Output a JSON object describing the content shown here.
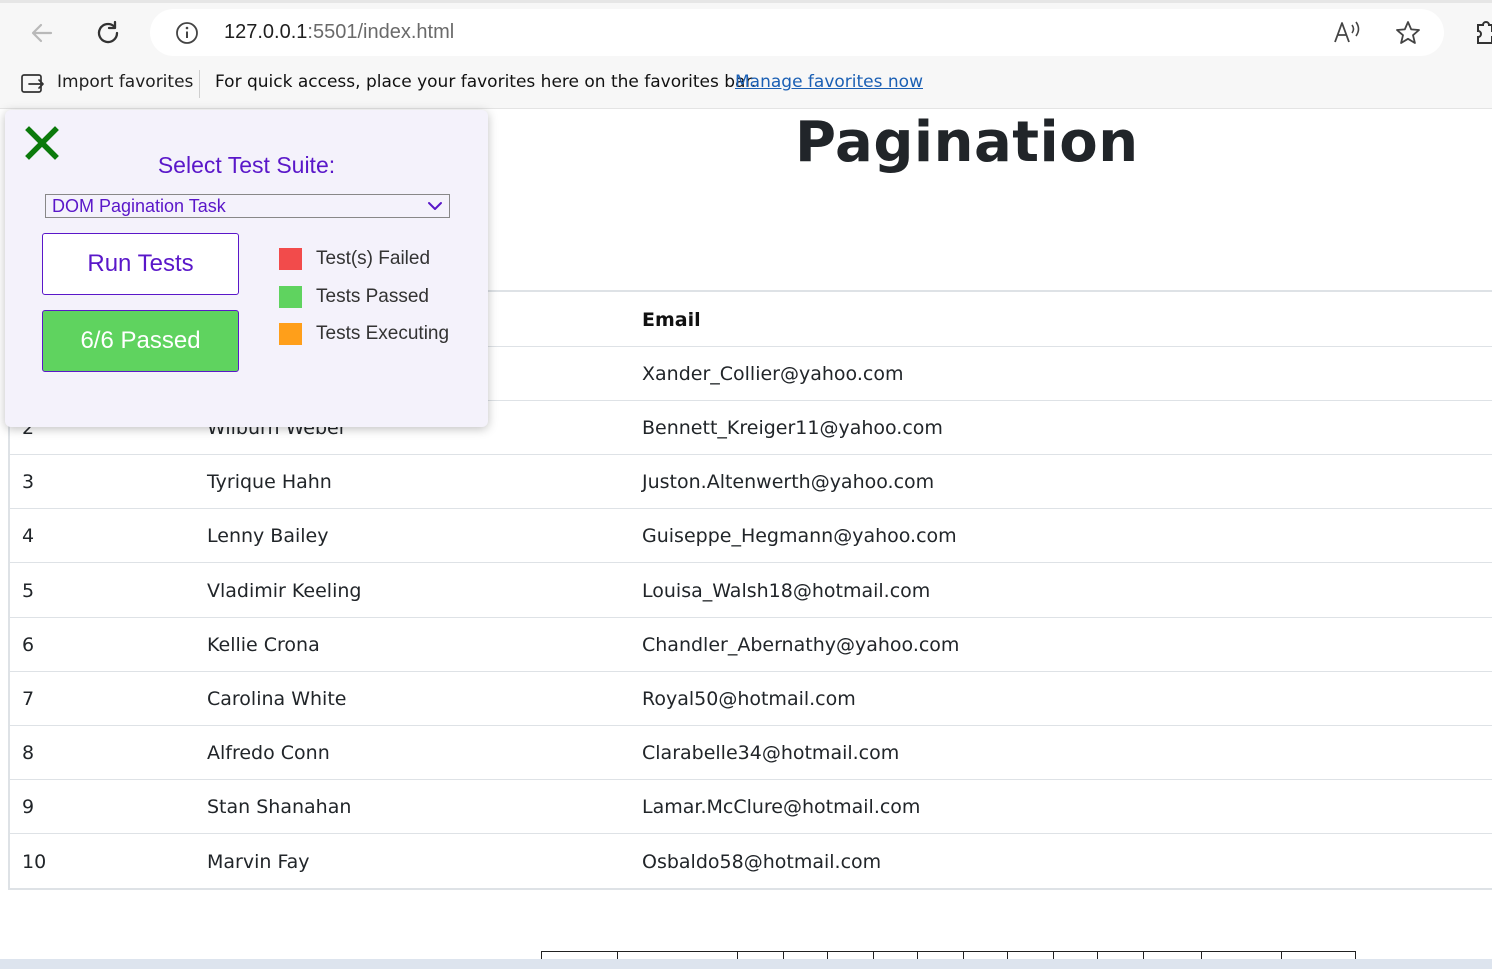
{
  "browser": {
    "url_host": "127.0.0.1",
    "url_path": ":5501/index.html",
    "read_aloud_glyph": "Aᴺ",
    "favorites_bar": {
      "import_label": "Import favorites",
      "message": "For quick access, place your favorites here on the favorites bar.",
      "manage_link": "Manage favorites now"
    }
  },
  "page": {
    "title": "Pagination",
    "table": {
      "columns": [
        "",
        "",
        "Email"
      ],
      "rows": [
        {
          "id": "2",
          "name": "Wilburn Weber",
          "email": "Bennett_Kreiger11@yahoo.com"
        },
        {
          "id": "3",
          "name": "Tyrique Hahn",
          "email": "Juston.Altenwerth@yahoo.com"
        },
        {
          "id": "4",
          "name": "Lenny Bailey",
          "email": "Guiseppe_Hegmann@yahoo.com"
        },
        {
          "id": "5",
          "name": "Vladimir Keeling",
          "email": "Louisa_Walsh18@hotmail.com"
        },
        {
          "id": "6",
          "name": "Kellie Crona",
          "email": "Chandler_Abernathy@yahoo.com"
        },
        {
          "id": "7",
          "name": "Carolina White",
          "email": "Royal50@hotmail.com"
        },
        {
          "id": "8",
          "name": "Alfredo Conn",
          "email": "Clarabelle34@hotmail.com"
        },
        {
          "id": "9",
          "name": "Stan Shanahan",
          "email": "Lamar.McClure@hotmail.com"
        },
        {
          "id": "10",
          "name": "Marvin Fay",
          "email": "Osbaldo58@hotmail.com"
        }
      ],
      "first_row_email": "Xander_Collier@yahoo.com"
    }
  },
  "test_panel": {
    "suite_label": "Select Test Suite:",
    "selected_suite": "DOM Pagination Task",
    "run_label": "Run Tests",
    "result_label": "6/6 Passed",
    "legend": [
      {
        "label": "Test(s) Failed",
        "color": "#f24b4b"
      },
      {
        "label": "Tests Passed",
        "color": "#5fd35f"
      },
      {
        "label": "Tests Executing",
        "color": "#ff9f1a"
      }
    ],
    "accent_color": "#5a17c9",
    "close_color": "#0b7a0b"
  }
}
